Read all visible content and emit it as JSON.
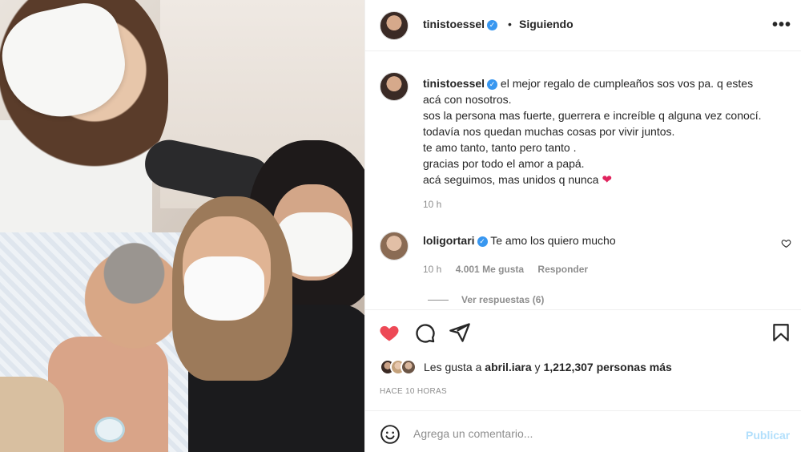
{
  "post": {
    "username": "tinistoessel",
    "dot": "•",
    "follow_status": "Siguiendo",
    "more": "•••"
  },
  "caption": {
    "username": "tinistoessel",
    "lines": [
      "el mejor regalo de cumpleaños sos vos pa. q estes",
      "acá con nosotros.",
      "sos la persona mas fuerte, guerrera e increíble q alguna vez conocí.",
      "todavía nos quedan muchas cosas por vivir juntos.",
      "te amo tanto, tanto pero tanto .",
      "gracias por todo el amor a papá.",
      "acá seguimos, mas unidos q nunca"
    ],
    "emoji": "❤",
    "time": "10 h"
  },
  "comment": {
    "username": "loligortari",
    "text": "Te amo los quiero mucho",
    "time": "10 h",
    "likes": "4.001 Me gusta",
    "reply": "Responder",
    "view_replies": "Ver respuestas (6)"
  },
  "likes": {
    "prefix": "Les gusta a",
    "user": "abril.iara",
    "conj": "y",
    "others": "1,212,307 personas más"
  },
  "posted_ago": "HACE 10 HORAS",
  "composer": {
    "placeholder": "Agrega un comentario...",
    "publish": "Publicar"
  },
  "colors": {
    "like_red": "#ed4956",
    "verified_blue": "#3897f0",
    "publish_disabled": "#b2dffc",
    "muted": "#8e8e8e"
  }
}
